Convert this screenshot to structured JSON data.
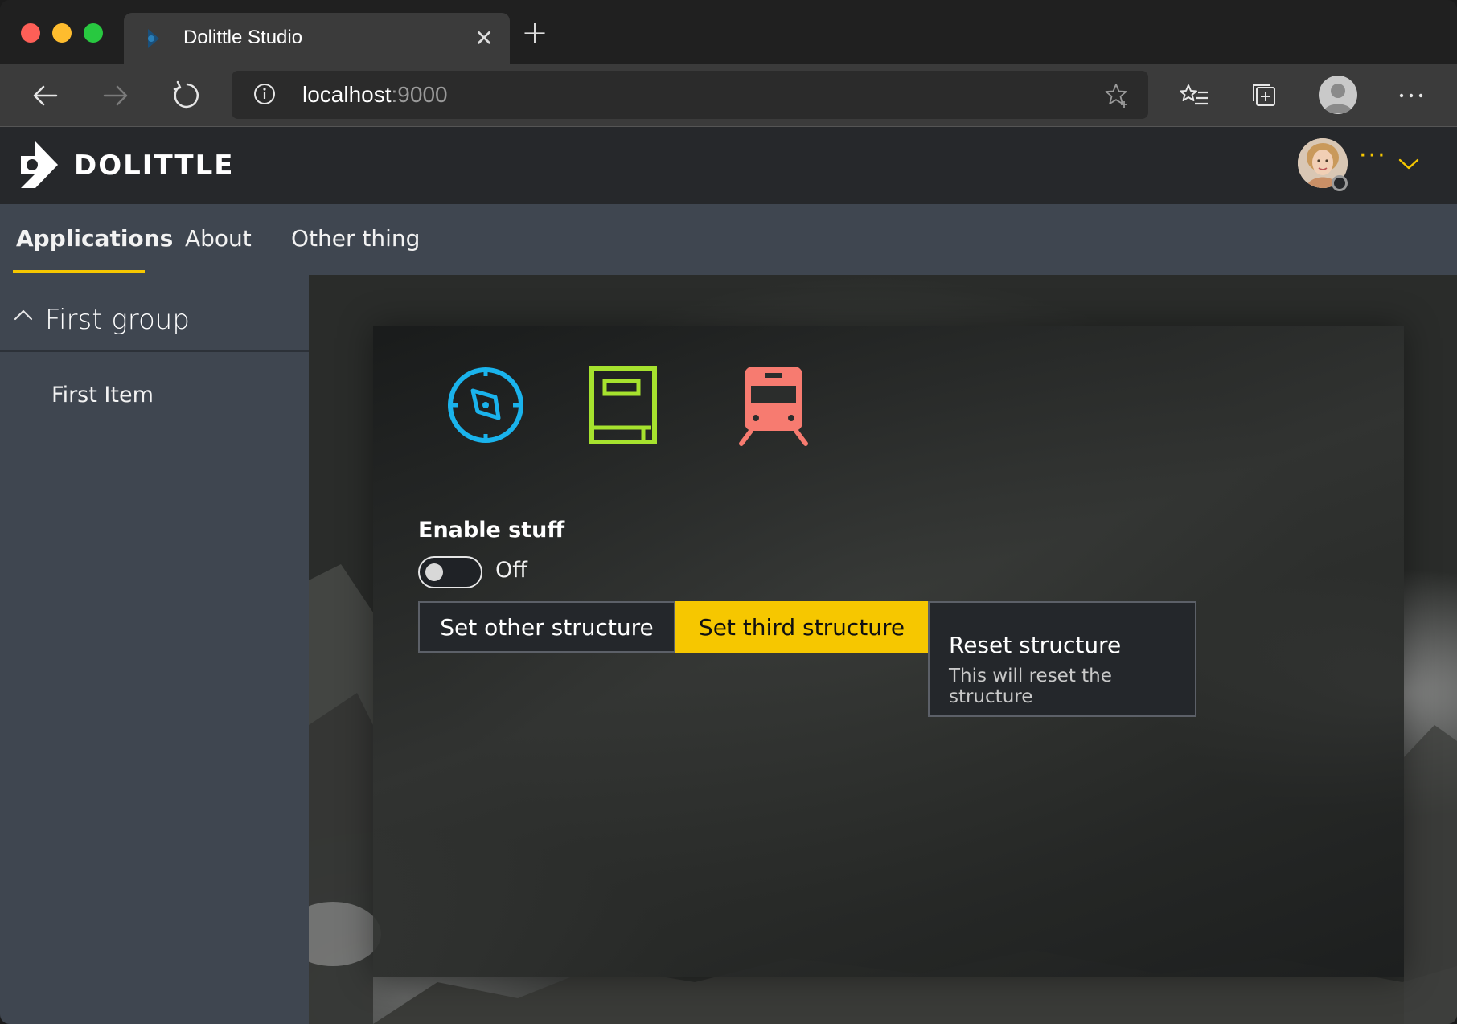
{
  "browser": {
    "tab_title": "Dolittle Studio",
    "close_glyph": "✕",
    "new_tab_glyph": "+",
    "address": {
      "host": "localhost",
      "port": ":9000"
    }
  },
  "app": {
    "logo_text": "DOLITTLE",
    "user_more": "···",
    "accent_color": "#f6c700"
  },
  "nav": {
    "items": [
      {
        "label": "Applications",
        "active": true
      },
      {
        "label": "About",
        "active": false
      },
      {
        "label": "Other thing",
        "active": false
      }
    ]
  },
  "sidebar": {
    "group_title": "First group",
    "items": [
      {
        "label": "First Item"
      }
    ]
  },
  "main": {
    "icons": [
      {
        "name": "compass-icon",
        "color": "#1ab3ec"
      },
      {
        "name": "book-icon",
        "color": "#a6e22e"
      },
      {
        "name": "train-icon",
        "color": "#f77b70"
      }
    ],
    "toggle": {
      "label": "Enable stuff",
      "state_text": "Off",
      "on": false
    },
    "buttons": {
      "other": "Set other structure",
      "third": "Set third structure",
      "reset_title": "Reset structure",
      "reset_desc": "This will reset the structure"
    }
  }
}
